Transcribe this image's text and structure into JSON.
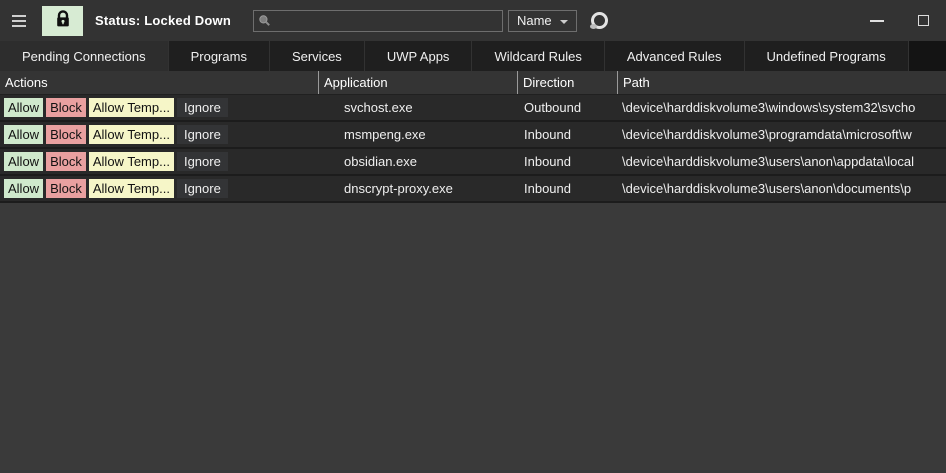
{
  "titlebar": {
    "status_label": "Status: Locked Down",
    "search_value": "",
    "search_placeholder": "",
    "filter_selected": "Name"
  },
  "tabs": [
    {
      "label": "Pending Connections",
      "selected": true
    },
    {
      "label": "Programs",
      "selected": false
    },
    {
      "label": "Services",
      "selected": false
    },
    {
      "label": "UWP Apps",
      "selected": false
    },
    {
      "label": "Wildcard Rules",
      "selected": false
    },
    {
      "label": "Advanced Rules",
      "selected": false
    },
    {
      "label": "Undefined Programs",
      "selected": false
    }
  ],
  "table": {
    "columns": {
      "actions": "Actions",
      "application": "Application",
      "direction": "Direction",
      "path": "Path"
    },
    "action_labels": {
      "allow": "Allow",
      "block": "Block",
      "allow_temp": "Allow Temp...",
      "ignore": "Ignore"
    },
    "rows": [
      {
        "application": "svchost.exe",
        "direction": "Outbound",
        "path": "\\device\\harddiskvolume3\\windows\\system32\\svcho"
      },
      {
        "application": "msmpeng.exe",
        "direction": "Inbound",
        "path": "\\device\\harddiskvolume3\\programdata\\microsoft\\w"
      },
      {
        "application": "obsidian.exe",
        "direction": "Inbound",
        "path": "\\device\\harddiskvolume3\\users\\anon\\appdata\\local"
      },
      {
        "application": "dnscrypt-proxy.exe",
        "direction": "Inbound",
        "path": "\\device\\harddiskvolume3\\users\\anon\\documents\\p"
      }
    ]
  },
  "colors": {
    "titlebar_bg": "#333333",
    "tabstrip_bg": "#141414",
    "tab_selected_bg": "#2d2d2d",
    "row_bg": "#292929",
    "empty_bg": "#3a3a3a",
    "allow_green": "#cfe9cc",
    "block_red": "#e9a0a0",
    "temp_yellow": "#f6f6c8",
    "lock_button_green": "#d7ebd3"
  }
}
